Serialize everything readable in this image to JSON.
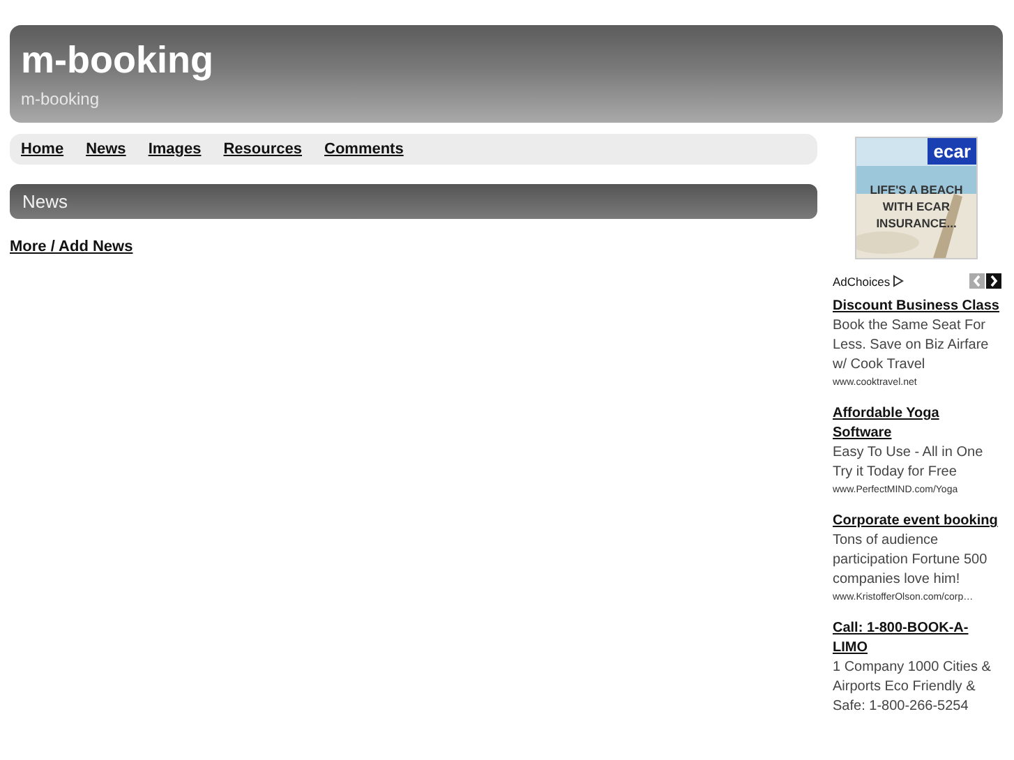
{
  "header": {
    "title": "m-booking",
    "subtitle": "m-booking"
  },
  "nav": [
    "Home",
    "News",
    "Images",
    "Resources",
    "Comments"
  ],
  "section": {
    "title": "News",
    "link": "More / Add News"
  },
  "banner": {
    "logo": "ecar",
    "headline": "LIFE'S A BEACH WITH ECAR INSURANCE..."
  },
  "adchoices": {
    "label": "AdChoices"
  },
  "ads": [
    {
      "title": "Discount Business Class",
      "text": "Book the Same Seat For Less. Save on Biz Airfare w/ Cook Travel",
      "url": "www.cooktravel.net"
    },
    {
      "title": "Affordable Yoga Software",
      "text": "Easy To Use - All in One Try it Today for Free",
      "url": "www.PerfectMIND.com/Yoga"
    },
    {
      "title": "Corporate event booking",
      "text": "Tons of audience participation Fortune 500 companies love him!",
      "url": "www.KristofferOlson.com/corp…"
    },
    {
      "title": "Call: 1-800-BOOK-A-LIMO",
      "text": "1 Company 1000 Cities & Airports Eco Friendly & Safe: 1-800-266-5254"
    }
  ]
}
